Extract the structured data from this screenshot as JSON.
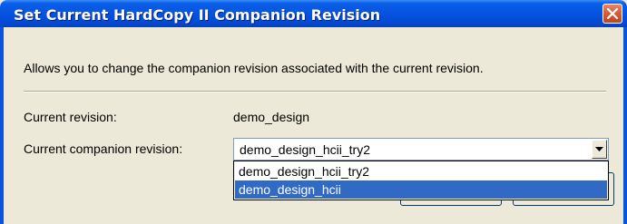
{
  "window": {
    "title": "Set Current HardCopy II Companion Revision",
    "close_label": "close"
  },
  "dialog": {
    "description": "Allows you to change the companion revision associated with the current revision.",
    "current_revision_label": "Current revision:",
    "current_revision_value": "demo_design",
    "companion_label": "Current companion revision:",
    "companion_selected": "demo_design_hcii_try2",
    "dropdown_options": [
      "demo_design_hcii_try2",
      "demo_design_hcii"
    ],
    "highlighted_option": "demo_design_hcii"
  },
  "colors": {
    "titlebar": "#0553e0",
    "dialog_bg": "#ece9d8",
    "selection": "#316ac5",
    "close_button": "#d65a34"
  },
  "icons": [
    "close-icon",
    "chevron-down-icon"
  ]
}
